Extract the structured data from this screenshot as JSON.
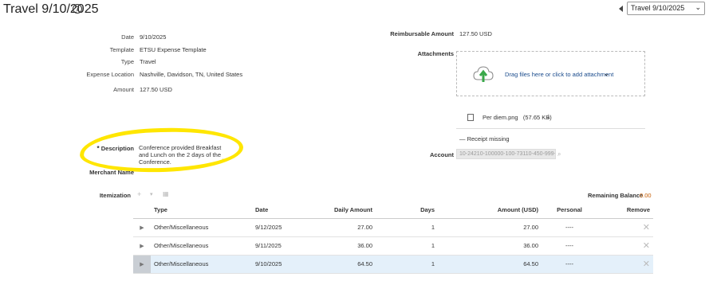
{
  "header": {
    "title": "Travel 9/10/2025",
    "help_icon": "help-circle-icon",
    "report_select_value": "Travel 9/10/2025"
  },
  "fields": {
    "date_label": "Date",
    "date_value": "9/10/2025",
    "template_label": "Template",
    "template_value": "ETSU Expense Template",
    "type_label": "Type",
    "type_value": "Travel",
    "location_label": "Expense Location",
    "location_value": "Nashville, Davidson, TN, United States",
    "amount_label": "Amount",
    "amount_value": "127.50 USD",
    "description_required_marker": "*",
    "description_label": "Description",
    "description_value": "Conference provided Breakfast and Lunch on the 2 days of the Conference.",
    "merchant_label": "Merchant Name",
    "reimbursable_label": "Reimbursable Amount",
    "reimbursable_value": "127.50 USD",
    "attachments_label": "Attachments",
    "dropzone_text": "Drag files here or click to add attachment",
    "attachment_file": "Per diem.png",
    "attachment_size": "(57.65 KB)",
    "receipt_missing": "Receipt missing",
    "account_label": "Account",
    "account_value": "10-24210-100000-100-73110-450-999-99"
  },
  "itemization": {
    "label": "Itemization",
    "remaining_label": "Remaining Balance",
    "remaining_value": "0.00",
    "columns": [
      "Type",
      "Date",
      "Daily Amount",
      "Days",
      "Amount (USD)",
      "Personal",
      "Remove"
    ],
    "rows": [
      {
        "type": "Other/Miscellaneous",
        "date": "9/12/2025",
        "daily_amount": "27.00",
        "days": "1",
        "amount": "27.00",
        "personal": "----"
      },
      {
        "type": "Other/Miscellaneous",
        "date": "9/11/2025",
        "daily_amount": "36.00",
        "days": "1",
        "amount": "36.00",
        "personal": "----"
      },
      {
        "type": "Other/Miscellaneous",
        "date": "9/10/2025",
        "daily_amount": "64.50",
        "days": "1",
        "amount": "64.50",
        "personal": "----"
      }
    ]
  },
  "colors": {
    "highlight": "#ffe600",
    "upload_arrow": "#3aa84a",
    "link": "#1a4b8c",
    "remaining_value": "#c75c00",
    "selected_row": "#e4f0fa"
  }
}
